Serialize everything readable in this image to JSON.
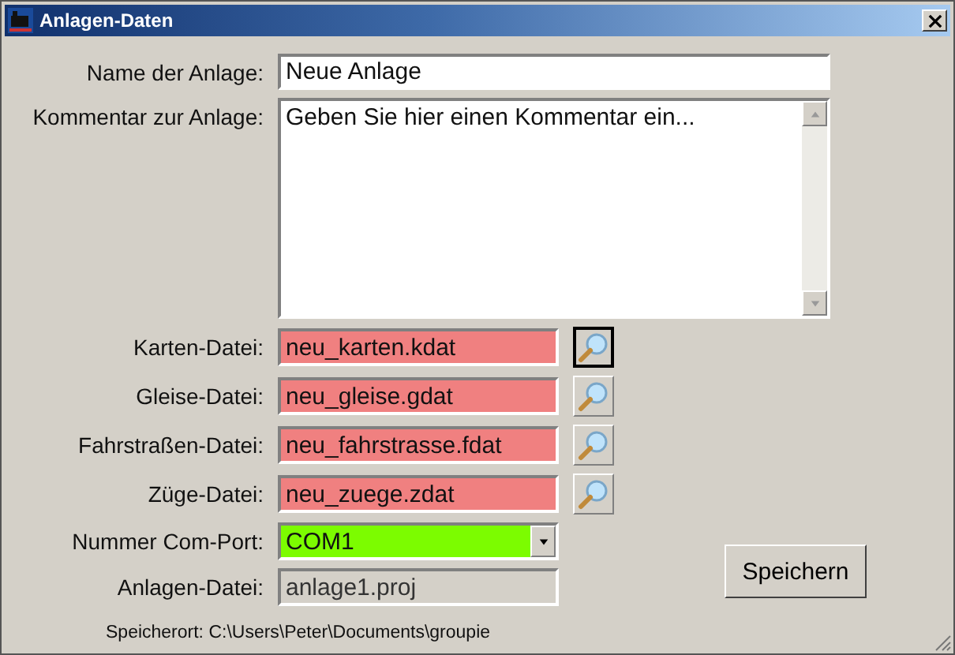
{
  "window": {
    "title": "Anlagen-Daten"
  },
  "name_field": {
    "label": "Name der Anlage:",
    "value": "Neue Anlage"
  },
  "comment_field": {
    "label": "Kommentar zur Anlage:",
    "value": "Geben Sie hier einen Kommentar ein..."
  },
  "files": [
    {
      "label": "Karten-Datei:",
      "value": "neu_karten.kdat",
      "valid": false,
      "focused": true
    },
    {
      "label": "Gleise-Datei:",
      "value": "neu_gleise.gdat",
      "valid": false,
      "focused": false
    },
    {
      "label": "Fahrstraßen-Datei:",
      "value": "neu_fahrstrasse.fdat",
      "valid": false,
      "focused": false
    },
    {
      "label": "Züge-Datei:",
      "value": "neu_zuege.zdat",
      "valid": false,
      "focused": false
    }
  ],
  "com_port": {
    "label": "Nummer Com-Port:",
    "value": "COM1",
    "valid": true
  },
  "project_file": {
    "label": "Anlagen-Datei:",
    "value": "anlage1.proj",
    "disabled": true
  },
  "save_location": "Speicherort: C:\\Users\\Peter\\Documents\\groupie",
  "save_button": "Speichern"
}
